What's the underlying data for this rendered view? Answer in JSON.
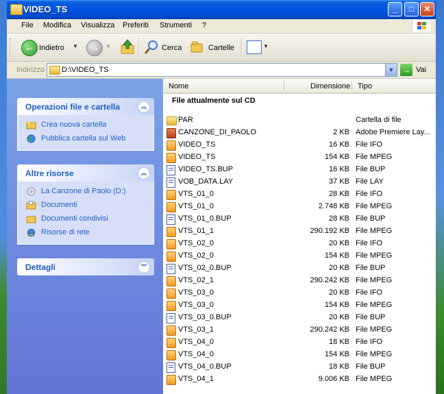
{
  "window": {
    "title": "VIDEO_TS"
  },
  "menu": [
    "File",
    "Modifica",
    "Visualizza",
    "Preferiti",
    "Strumenti",
    "?"
  ],
  "toolbar": {
    "back_label": "Indietro",
    "search_label": "Cerca",
    "folders_label": "Cartelle"
  },
  "address": {
    "label": "Indirizzo",
    "value": "D:\\VIDEO_TS",
    "go_label": "Vai"
  },
  "tasks": {
    "title": "Operazioni file e cartella",
    "items": [
      "Crea nuova cartella",
      "Pubblica cartella sul Web"
    ]
  },
  "other_places": {
    "title": "Altre risorse",
    "items": [
      "La Canzone di Paolo (D:)",
      "Documenti",
      "Documenti condivisi",
      "Risorse di rete"
    ]
  },
  "details": {
    "title": "Dettagli"
  },
  "columns": {
    "name": "Nome",
    "size": "Dimensione",
    "type": "Tipo"
  },
  "group_title": "File attualmente sul CD",
  "files": [
    {
      "name": "PAR",
      "size": "",
      "type": "Cartella di file",
      "icon": "folder"
    },
    {
      "name": "CANZONE_DI_PAOLO",
      "size": "2 KB",
      "type": "Adobe Premiere Lay...",
      "icon": "prem"
    },
    {
      "name": "VIDEO_TS",
      "size": "16 KB",
      "type": "File IFO",
      "icon": "vid"
    },
    {
      "name": "VIDEO_TS",
      "size": "154 KB",
      "type": "File MPEG",
      "icon": "vid"
    },
    {
      "name": "VIDEO_TS.BUP",
      "size": "16 KB",
      "type": "File BUP",
      "icon": "doc"
    },
    {
      "name": "VOB_DATA.LAY",
      "size": "37 KB",
      "type": "File LAY",
      "icon": "doc"
    },
    {
      "name": "VTS_01_0",
      "size": "28 KB",
      "type": "File IFO",
      "icon": "vid"
    },
    {
      "name": "VTS_01_0",
      "size": "2.748 KB",
      "type": "File MPEG",
      "icon": "vid"
    },
    {
      "name": "VTS_01_0.BUP",
      "size": "28 KB",
      "type": "File BUP",
      "icon": "doc"
    },
    {
      "name": "VTS_01_1",
      "size": "290.192 KB",
      "type": "File MPEG",
      "icon": "vid"
    },
    {
      "name": "VTS_02_0",
      "size": "20 KB",
      "type": "File IFO",
      "icon": "vid"
    },
    {
      "name": "VTS_02_0",
      "size": "154 KB",
      "type": "File MPEG",
      "icon": "vid"
    },
    {
      "name": "VTS_02_0.BUP",
      "size": "20 KB",
      "type": "File BUP",
      "icon": "doc"
    },
    {
      "name": "VTS_02_1",
      "size": "290.242 KB",
      "type": "File MPEG",
      "icon": "vid"
    },
    {
      "name": "VTS_03_0",
      "size": "20 KB",
      "type": "File IFO",
      "icon": "vid"
    },
    {
      "name": "VTS_03_0",
      "size": "154 KB",
      "type": "File MPEG",
      "icon": "vid"
    },
    {
      "name": "VTS_03_0.BUP",
      "size": "20 KB",
      "type": "File BUP",
      "icon": "doc"
    },
    {
      "name": "VTS_03_1",
      "size": "290.242 KB",
      "type": "File MPEG",
      "icon": "vid"
    },
    {
      "name": "VTS_04_0",
      "size": "18 KB",
      "type": "File IFO",
      "icon": "vid"
    },
    {
      "name": "VTS_04_0",
      "size": "154 KB",
      "type": "File MPEG",
      "icon": "vid"
    },
    {
      "name": "VTS_04_0.BUP",
      "size": "18 KB",
      "type": "File BUP",
      "icon": "doc"
    },
    {
      "name": "VTS_04_1",
      "size": "9.006 KB",
      "type": "File MPEG",
      "icon": "vid"
    }
  ]
}
